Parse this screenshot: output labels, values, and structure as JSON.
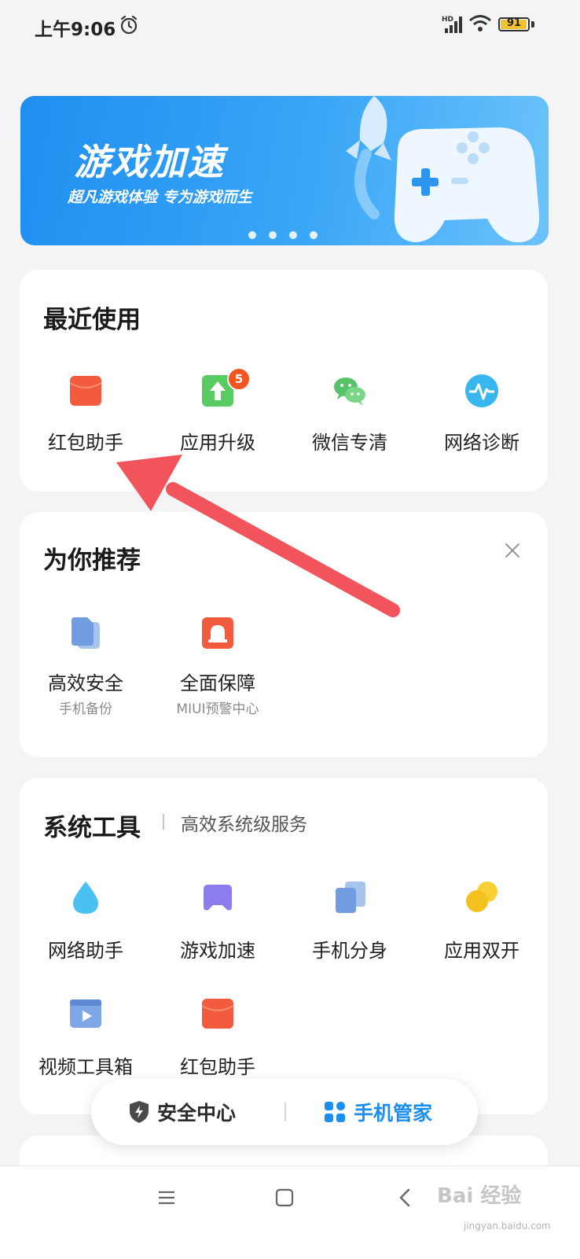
{
  "status_bar": {
    "time": "上午9:06",
    "network": "HD",
    "battery": "91",
    "battery_level": 0.91
  },
  "banner": {
    "title": "游戏加速",
    "subtitle": "超凡游戏体验 专为游戏而生",
    "page_count": 4,
    "active_page": 1
  },
  "recent": {
    "title": "最近使用",
    "items": [
      {
        "label": "红包助手",
        "icon": "red-envelope-icon"
      },
      {
        "label": "应用升级",
        "icon": "app-upgrade-icon",
        "badge": "5"
      },
      {
        "label": "微信专清",
        "icon": "wechat-icon"
      },
      {
        "label": "网络诊断",
        "icon": "network-diagnosis-icon"
      }
    ]
  },
  "recommend": {
    "title": "为你推荐",
    "items": [
      {
        "label": "高效安全",
        "sub": "手机备份",
        "icon": "backup-icon"
      },
      {
        "label": "全面保障",
        "sub": "MIUI预警中心",
        "icon": "alarm-bell-icon"
      }
    ]
  },
  "tools": {
    "title": "系统工具",
    "subtitle": "高效系统级服务",
    "items": [
      {
        "label": "网络助手",
        "icon": "water-drop-icon"
      },
      {
        "label": "游戏加速",
        "icon": "gamepad-icon"
      },
      {
        "label": "手机分身",
        "icon": "clone-icon"
      },
      {
        "label": "应用双开",
        "icon": "dual-app-icon"
      },
      {
        "label": "视频工具箱",
        "icon": "video-toolbox-icon"
      },
      {
        "label": "红包助手",
        "icon": "red-envelope-icon"
      }
    ]
  },
  "tabs": [
    {
      "label": "安全中心",
      "icon": "shield-icon",
      "active": false
    },
    {
      "label": "手机管家",
      "icon": "grid-icon",
      "active": true
    }
  ],
  "watermark": {
    "text": "Bai 经验",
    "sub": "jingyan.baidu.com"
  },
  "colors": {
    "accent": "#1a8ff0",
    "badge": "#f4541f",
    "annotation_arrow": "#f2545b"
  }
}
